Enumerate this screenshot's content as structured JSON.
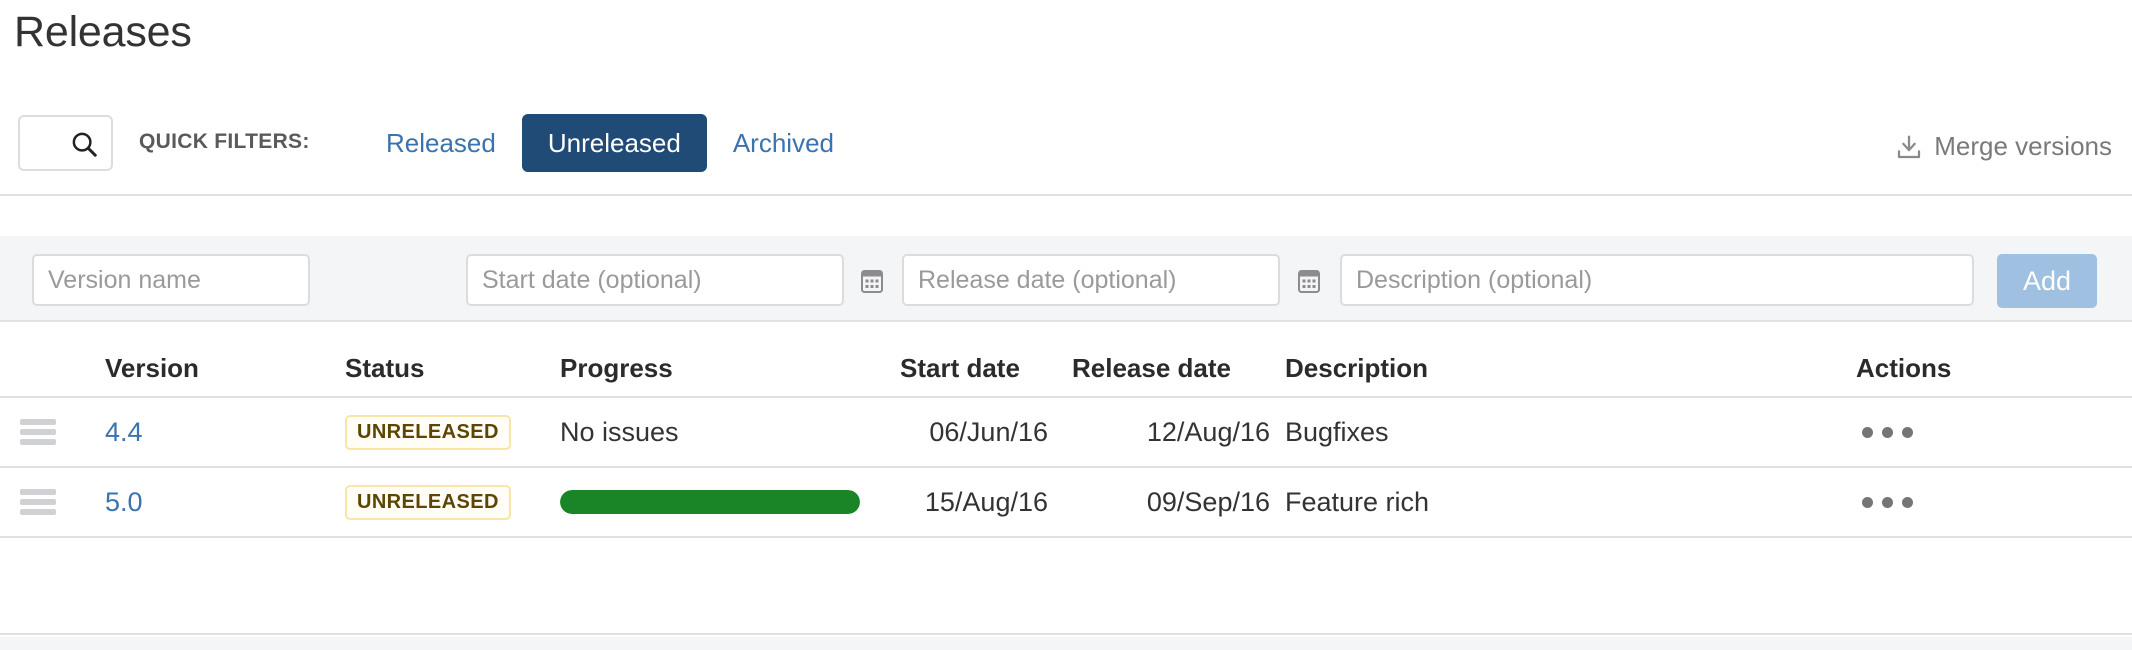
{
  "page": {
    "title": "Releases"
  },
  "toolbar": {
    "search": {
      "value": "",
      "placeholder": "",
      "icon": "search-icon"
    },
    "quick_filters_label": "QUICK FILTERS:",
    "filters": [
      {
        "label": "Released",
        "active": false
      },
      {
        "label": "Unreleased",
        "active": true
      },
      {
        "label": "Archived",
        "active": false
      }
    ],
    "merge_versions": {
      "label": "Merge versions",
      "icon": "merge-versions-icon"
    },
    "colors": {
      "active_chip_bg": "#1f4b76",
      "link": "#3b73af"
    }
  },
  "add_form": {
    "version_name": {
      "value": "",
      "placeholder": "Version name"
    },
    "start_date": {
      "value": "",
      "placeholder": "Start date (optional)",
      "icon": "calendar-icon"
    },
    "release_date": {
      "value": "",
      "placeholder": "Release date (optional)",
      "icon": "calendar-icon"
    },
    "description": {
      "value": "",
      "placeholder": "Description (optional)"
    },
    "add_button": {
      "label": "Add",
      "disabled": true,
      "color": "#9fc0e0"
    }
  },
  "table": {
    "columns": [
      "Version",
      "Status",
      "Progress",
      "Start date",
      "Release date",
      "Description",
      "Actions"
    ],
    "rows": [
      {
        "version": "4.4",
        "status": "UNRELEASED",
        "progress_type": "text",
        "progress_text": "No issues",
        "progress_percent": 0,
        "start_date": "06/Jun/16",
        "release_date": "12/Aug/16",
        "description": "Bugfixes",
        "actions_icon": "more-actions-icon"
      },
      {
        "version": "5.0",
        "status": "UNRELEASED",
        "progress_type": "bar",
        "progress_text": "",
        "progress_percent": 100,
        "start_date": "15/Aug/16",
        "release_date": "09/Sep/16",
        "description": "Feature rich",
        "actions_icon": "more-actions-icon"
      }
    ],
    "colors": {
      "badge_text": "#5d4604",
      "badge_border": "#f7e6a8",
      "progress_green": "#1a8526"
    }
  }
}
